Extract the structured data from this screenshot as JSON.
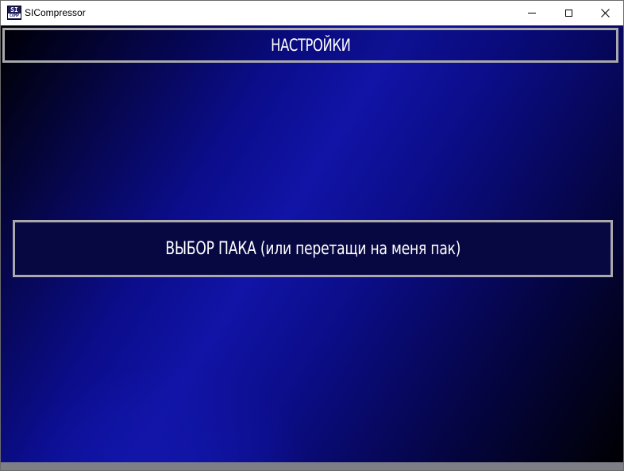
{
  "window": {
    "title": "SICompressor",
    "icon_name": "sicompressor-app-icon",
    "icon_text_top": "SI",
    "icon_text_bottom": "COMP"
  },
  "controls": {
    "minimize_icon": "minimize-icon",
    "maximize_icon": "maximize-icon",
    "close_icon": "close-icon"
  },
  "header": {
    "title": "НАСТРОЙКИ"
  },
  "main": {
    "select_pack_label": "ВЫБОР ПАКА (или перетащи на меня пак)"
  },
  "colors": {
    "background_dark": "#000000",
    "background_blue": "#1114a6",
    "border": "#a9a9ad",
    "button_fill": "#070742",
    "text": "#ffffff",
    "bottom_bar": "#7e7e86"
  }
}
